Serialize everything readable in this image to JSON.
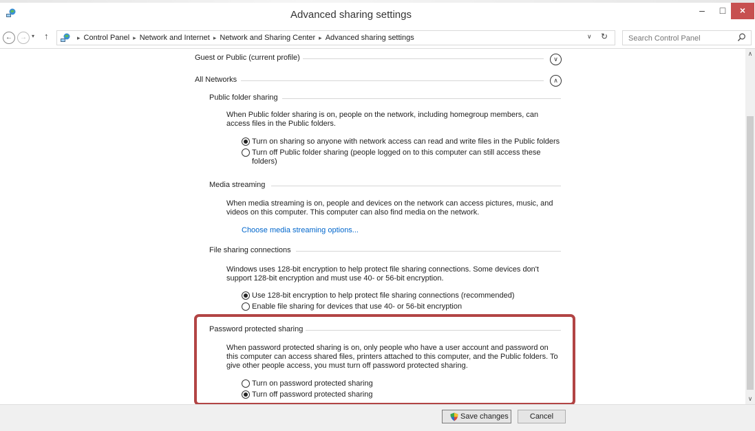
{
  "window": {
    "title": "Advanced sharing settings",
    "minimize": "–",
    "maximize": "□",
    "close": "×"
  },
  "address": {
    "back": "←",
    "forward": "→",
    "recent": "▾",
    "up": "↑",
    "separator": "▸",
    "breadcrumbs": [
      "Control Panel",
      "Network and Internet",
      "Network and Sharing Center",
      "Advanced sharing settings"
    ],
    "dropdown": "∨",
    "refresh": "↻",
    "search_placeholder": "Search Control Panel"
  },
  "profiles": {
    "guest": {
      "label": "Guest or Public (current profile)",
      "toggle": "∨"
    },
    "all": {
      "label": "All Networks",
      "toggle": "∧"
    }
  },
  "sections": {
    "public_folder": {
      "heading": "Public folder sharing",
      "description": "When Public folder sharing is on, people on the network, including homegroup members, can access files in the Public folders.",
      "options": [
        {
          "label": "Turn on sharing so anyone with network access can read and write files in the Public folders",
          "checked": true
        },
        {
          "label": "Turn off Public folder sharing (people logged on to this computer can still access these folders)",
          "checked": false
        }
      ]
    },
    "media": {
      "heading": "Media streaming",
      "description": "When media streaming is on, people and devices on the network can access pictures, music, and videos on this computer. This computer can also find media on the network.",
      "link": "Choose media streaming options..."
    },
    "file_sharing": {
      "heading": "File sharing connections",
      "description": "Windows uses 128-bit encryption to help protect file sharing connections. Some devices don't support 128-bit encryption and must use 40- or 56-bit encryption.",
      "options": [
        {
          "label": "Use 128-bit encryption to help protect file sharing connections (recommended)",
          "checked": true
        },
        {
          "label": "Enable file sharing for devices that use 40- or 56-bit encryption",
          "checked": false
        }
      ]
    },
    "password": {
      "heading": "Password protected sharing",
      "description": "When password protected sharing is on, only people who have a user account and password on this computer can access shared files, printers attached to this computer, and the Public folders. To give other people access, you must turn off password protected sharing.",
      "options": [
        {
          "label": "Turn on password protected sharing",
          "checked": false
        },
        {
          "label": "Turn off password protected sharing",
          "checked": true
        }
      ]
    }
  },
  "buttons": {
    "save": "Save changes",
    "cancel": "Cancel"
  },
  "colors": {
    "highlight": "#b24444",
    "link": "#0066cc",
    "close_button": "#c75050"
  }
}
